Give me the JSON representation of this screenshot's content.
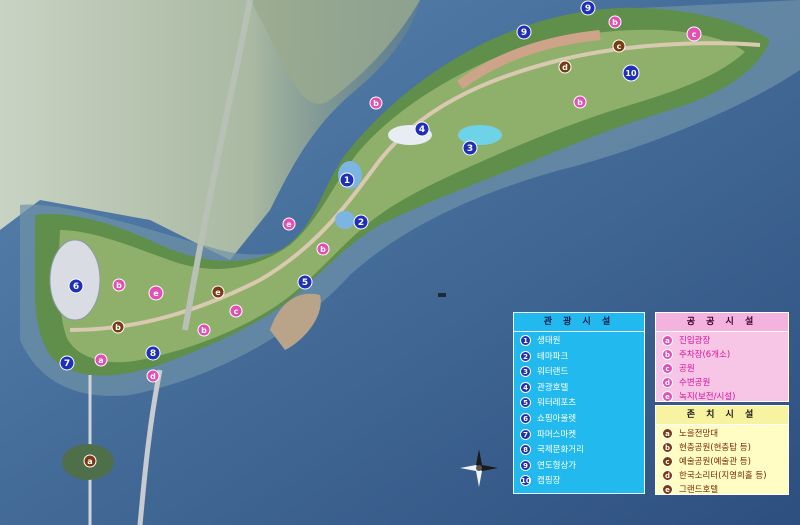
{
  "colors": {
    "sea": "#3b5f8d",
    "tour_panel": "#22b9ee",
    "tour_marker": "#1f2fb8",
    "public_panel": "#f7c6e6",
    "public_marker": "#e24fb5",
    "special_panel": "#fffcc4",
    "special_marker": "#7a3b12"
  },
  "map_markers": {
    "tour": [
      "1",
      "2",
      "3",
      "4",
      "5",
      "6",
      "7",
      "8",
      "9",
      "10"
    ],
    "public": [
      "a",
      "b",
      "c",
      "d",
      "e"
    ],
    "special": [
      "a",
      "b",
      "c",
      "d"
    ]
  },
  "legend": {
    "tour": {
      "title": "관 광 시 설",
      "items": [
        {
          "num": "1",
          "label": "생태원"
        },
        {
          "num": "2",
          "label": "테마파크"
        },
        {
          "num": "3",
          "label": "워터랜드"
        },
        {
          "num": "4",
          "label": "관광호텔"
        },
        {
          "num": "5",
          "label": "워터레포츠"
        },
        {
          "num": "6",
          "label": "쇼핑아울렛"
        },
        {
          "num": "7",
          "label": "파머스마켓"
        },
        {
          "num": "8",
          "label": "국제문화거리"
        },
        {
          "num": "9",
          "label": "연도형상가"
        },
        {
          "num": "10",
          "label": "캠핑장"
        }
      ]
    },
    "public": {
      "title": "공 공 시 설",
      "items": [
        {
          "num": "a",
          "label": "진입광장"
        },
        {
          "num": "b",
          "label": "주차장(6개소)"
        },
        {
          "num": "c",
          "label": "공원"
        },
        {
          "num": "d",
          "label": "수변공원"
        },
        {
          "num": "e",
          "label": "녹지(보전/시설)"
        }
      ]
    },
    "special": {
      "title": "존 치 시 설",
      "items": [
        {
          "num": "a",
          "label": "노을전망대"
        },
        {
          "num": "b",
          "label": "현충공원(현충탑 등)"
        },
        {
          "num": "c",
          "label": "예술공원(예술관 등)"
        },
        {
          "num": "d",
          "label": "한국소리터(지영희홀 등)"
        },
        {
          "num": "e",
          "label": "그랜드호텔"
        }
      ]
    }
  }
}
